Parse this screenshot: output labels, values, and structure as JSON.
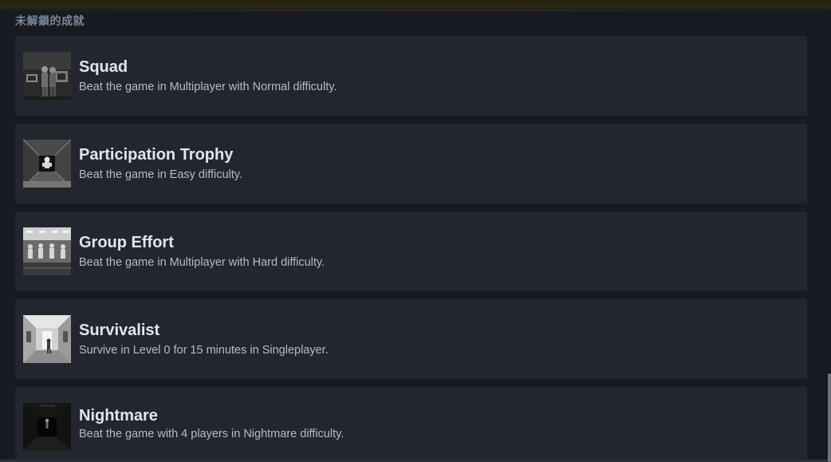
{
  "section": {
    "header": "未解鎖的成就"
  },
  "achievements": [
    {
      "title": "Squad",
      "description": "Beat the game in Multiplayer with Normal difficulty.",
      "icon": "squad-achievement-icon"
    },
    {
      "title": "Participation Trophy",
      "description": "Beat the game in Easy difficulty.",
      "icon": "participation-trophy-achievement-icon"
    },
    {
      "title": "Group Effort",
      "description": "Beat the game in Multiplayer with Hard difficulty.",
      "icon": "group-effort-achievement-icon"
    },
    {
      "title": "Survivalist",
      "description": "Survive in Level 0 for 15 minutes in Singleplayer.",
      "icon": "survivalist-achievement-icon"
    },
    {
      "title": "Nightmare",
      "description": "Beat the game with 4 players in Nightmare difficulty.",
      "icon": "nightmare-achievement-icon"
    }
  ],
  "colors": {
    "background": "#171a21",
    "card": "#23262e",
    "title": "#e3e6ea",
    "description": "#b5bcc7",
    "section_header": "#7b8797"
  }
}
